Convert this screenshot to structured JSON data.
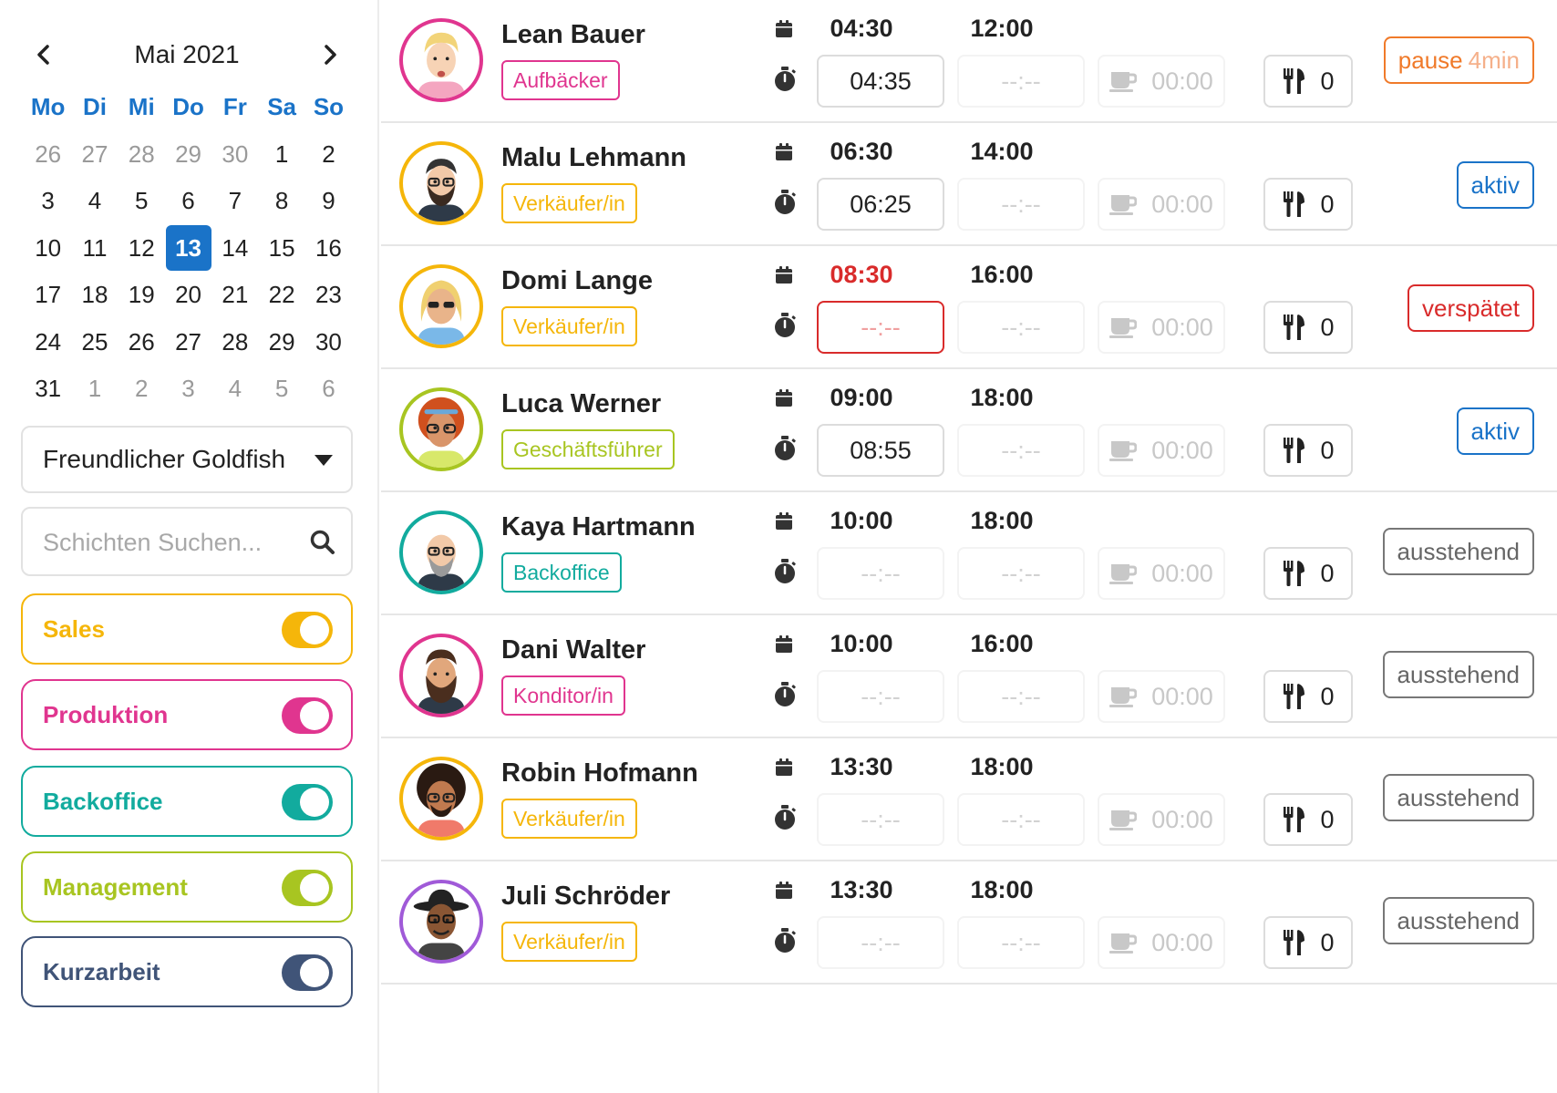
{
  "calendar": {
    "title": "Mai 2021",
    "weekdays": [
      "Mo",
      "Di",
      "Mi",
      "Do",
      "Fr",
      "Sa",
      "So"
    ],
    "days": [
      {
        "d": "26",
        "muted": true
      },
      {
        "d": "27",
        "muted": true
      },
      {
        "d": "28",
        "muted": true
      },
      {
        "d": "29",
        "muted": true
      },
      {
        "d": "30",
        "muted": true
      },
      {
        "d": "1"
      },
      {
        "d": "2"
      },
      {
        "d": "3"
      },
      {
        "d": "4"
      },
      {
        "d": "5"
      },
      {
        "d": "6"
      },
      {
        "d": "7"
      },
      {
        "d": "8"
      },
      {
        "d": "9"
      },
      {
        "d": "10"
      },
      {
        "d": "11"
      },
      {
        "d": "12"
      },
      {
        "d": "13",
        "selected": true
      },
      {
        "d": "14"
      },
      {
        "d": "15"
      },
      {
        "d": "16"
      },
      {
        "d": "17"
      },
      {
        "d": "18"
      },
      {
        "d": "19"
      },
      {
        "d": "20"
      },
      {
        "d": "21"
      },
      {
        "d": "22"
      },
      {
        "d": "23"
      },
      {
        "d": "24"
      },
      {
        "d": "25"
      },
      {
        "d": "26"
      },
      {
        "d": "27"
      },
      {
        "d": "28"
      },
      {
        "d": "29"
      },
      {
        "d": "30"
      },
      {
        "d": "31"
      },
      {
        "d": "1",
        "muted": true
      },
      {
        "d": "2",
        "muted": true
      },
      {
        "d": "3",
        "muted": true
      },
      {
        "d": "4",
        "muted": true
      },
      {
        "d": "5",
        "muted": true
      },
      {
        "d": "6",
        "muted": true
      }
    ]
  },
  "org_select": {
    "value": "Freundlicher Goldfish"
  },
  "search": {
    "placeholder": "Schichten Suchen..."
  },
  "filters": [
    {
      "label": "Sales",
      "color": "#f5b60a",
      "on": true
    },
    {
      "label": "Produktion",
      "color": "#e0358f",
      "on": true
    },
    {
      "label": "Backoffice",
      "color": "#12ab9e",
      "on": true
    },
    {
      "label": "Management",
      "color": "#a8c521",
      "on": true
    },
    {
      "label": "Kurzarbeit",
      "color": "#405478",
      "on": true
    }
  ],
  "shifts": [
    {
      "name": "Lean Bauer",
      "role": "Aufbäcker",
      "role_color": "#e0358f",
      "ring": "#e0358f",
      "avatar": "blond",
      "planned_start": "04:30",
      "planned_end": "12:00",
      "clock_in": "04:35",
      "clock_out": "--:--",
      "break_time": "00:00",
      "meals": "0",
      "status": "pause",
      "status_label": "pause",
      "status_extra": "4min"
    },
    {
      "name": "Malu Lehmann",
      "role": "Verkäufer/in",
      "role_color": "#f5b60a",
      "ring": "#f5b60a",
      "avatar": "beard",
      "planned_start": "06:30",
      "planned_end": "14:00",
      "clock_in": "06:25",
      "clock_out": "--:--",
      "break_time": "00:00",
      "meals": "0",
      "status": "aktiv",
      "status_label": "aktiv"
    },
    {
      "name": "Domi Lange",
      "role": "Verkäufer/in",
      "role_color": "#f5b60a",
      "ring": "#f5b60a",
      "avatar": "blonde-woman",
      "planned_start": "08:30",
      "planned_end": "16:00",
      "clock_in": "--:--",
      "clock_out": "--:--",
      "break_time": "00:00",
      "meals": "0",
      "status": "late",
      "status_label": "verspätet"
    },
    {
      "name": "Luca Werner",
      "role": "Geschäftsführer",
      "role_color": "#a8c521",
      "ring": "#a8c521",
      "avatar": "redhair",
      "planned_start": "09:00",
      "planned_end": "18:00",
      "clock_in": "08:55",
      "clock_out": "--:--",
      "break_time": "00:00",
      "meals": "0",
      "status": "aktiv",
      "status_label": "aktiv"
    },
    {
      "name": "Kaya Hartmann",
      "role": "Backoffice",
      "role_color": "#12ab9e",
      "ring": "#12ab9e",
      "avatar": "bald",
      "planned_start": "10:00",
      "planned_end": "18:00",
      "clock_in": "--:--",
      "clock_out": "--:--",
      "break_time": "00:00",
      "meals": "0",
      "status": "pend",
      "status_label": "ausstehend"
    },
    {
      "name": "Dani Walter",
      "role": "Konditor/in",
      "role_color": "#e0358f",
      "ring": "#e0358f",
      "avatar": "bigbeard",
      "planned_start": "10:00",
      "planned_end": "16:00",
      "clock_in": "--:--",
      "clock_out": "--:--",
      "break_time": "00:00",
      "meals": "0",
      "status": "pend",
      "status_label": "ausstehend"
    },
    {
      "name": "Robin Hofmann",
      "role": "Verkäufer/in",
      "role_color": "#f5b60a",
      "ring": "#f5b60a",
      "avatar": "afro",
      "planned_start": "13:30",
      "planned_end": "18:00",
      "clock_in": "--:--",
      "clock_out": "--:--",
      "break_time": "00:00",
      "meals": "0",
      "status": "pend",
      "status_label": "ausstehend"
    },
    {
      "name": "Juli Schröder",
      "role": "Verkäufer/in",
      "role_color": "#f5b60a",
      "ring": "#a05ad8",
      "avatar": "hat",
      "planned_start": "13:30",
      "planned_end": "18:00",
      "clock_in": "--:--",
      "clock_out": "--:--",
      "break_time": "00:00",
      "meals": "0",
      "status": "pend",
      "status_label": "ausstehend"
    }
  ],
  "icons": {
    "prev": "chevron-left-icon",
    "next": "chevron-right-icon",
    "search": "search-icon",
    "planned": "calendar-icon",
    "actual": "stopwatch-icon",
    "break": "coffee-cup-icon",
    "meal": "fork-knife-icon"
  }
}
